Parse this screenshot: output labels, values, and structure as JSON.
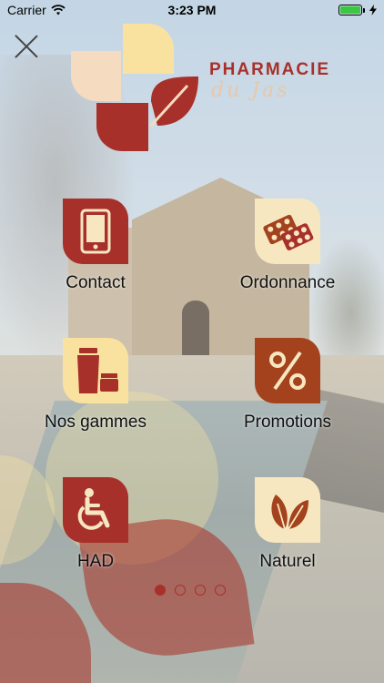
{
  "status_bar": {
    "carrier": "Carrier",
    "time": "3:23 PM"
  },
  "logo": {
    "line1": "PHARMACIE",
    "line2": "du Jas"
  },
  "menu": [
    {
      "label": "Contact",
      "icon": "phone-icon"
    },
    {
      "label": "Ordonnance",
      "icon": "pills-icon"
    },
    {
      "label": "Nos gammes",
      "icon": "cosmetics-icon"
    },
    {
      "label": "Promotions",
      "icon": "percent-icon"
    },
    {
      "label": "HAD",
      "icon": "wheelchair-icon"
    },
    {
      "label": "Naturel",
      "icon": "leaves-icon"
    }
  ],
  "pagination": {
    "pages": 4,
    "current": 1
  },
  "colors": {
    "accent_red": "#a8302a",
    "cream": "#f7e7c1",
    "yellow": "#f9e2a0",
    "brown": "#a3421c"
  }
}
